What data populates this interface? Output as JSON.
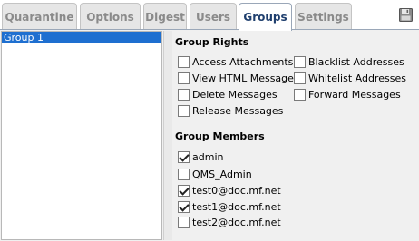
{
  "tabs": [
    {
      "label": "Quarantine"
    },
    {
      "label": "Options"
    },
    {
      "label": "Digest"
    },
    {
      "label": "Users"
    },
    {
      "label": "Groups"
    },
    {
      "label": "Settings"
    }
  ],
  "active_tab": "Groups",
  "groups": [
    {
      "label": "Group 1",
      "selected": true
    }
  ],
  "rights": {
    "heading": "Group Rights",
    "items": [
      {
        "label": "Access Attachments",
        "checked": false
      },
      {
        "label": "View HTML Messages",
        "checked": false
      },
      {
        "label": "Delete Messages",
        "checked": false
      },
      {
        "label": "Release Messages",
        "checked": false
      },
      {
        "label": "Blacklist Addresses",
        "checked": false
      },
      {
        "label": "Whitelist Addresses",
        "checked": false
      },
      {
        "label": "Forward Messages",
        "checked": false
      }
    ]
  },
  "members": {
    "heading": "Group Members",
    "items": [
      {
        "label": "admin",
        "checked": true
      },
      {
        "label": "QMS_Admin",
        "checked": false
      },
      {
        "label": "test0@doc.mf.net",
        "checked": true
      },
      {
        "label": "test1@doc.mf.net",
        "checked": true
      },
      {
        "label": "test2@doc.mf.net",
        "checked": false
      }
    ]
  },
  "icons": {
    "save": "save-disk-icon"
  },
  "colors": {
    "accent": "#1e6fd0",
    "active_tab_text": "#1f3f6e"
  }
}
